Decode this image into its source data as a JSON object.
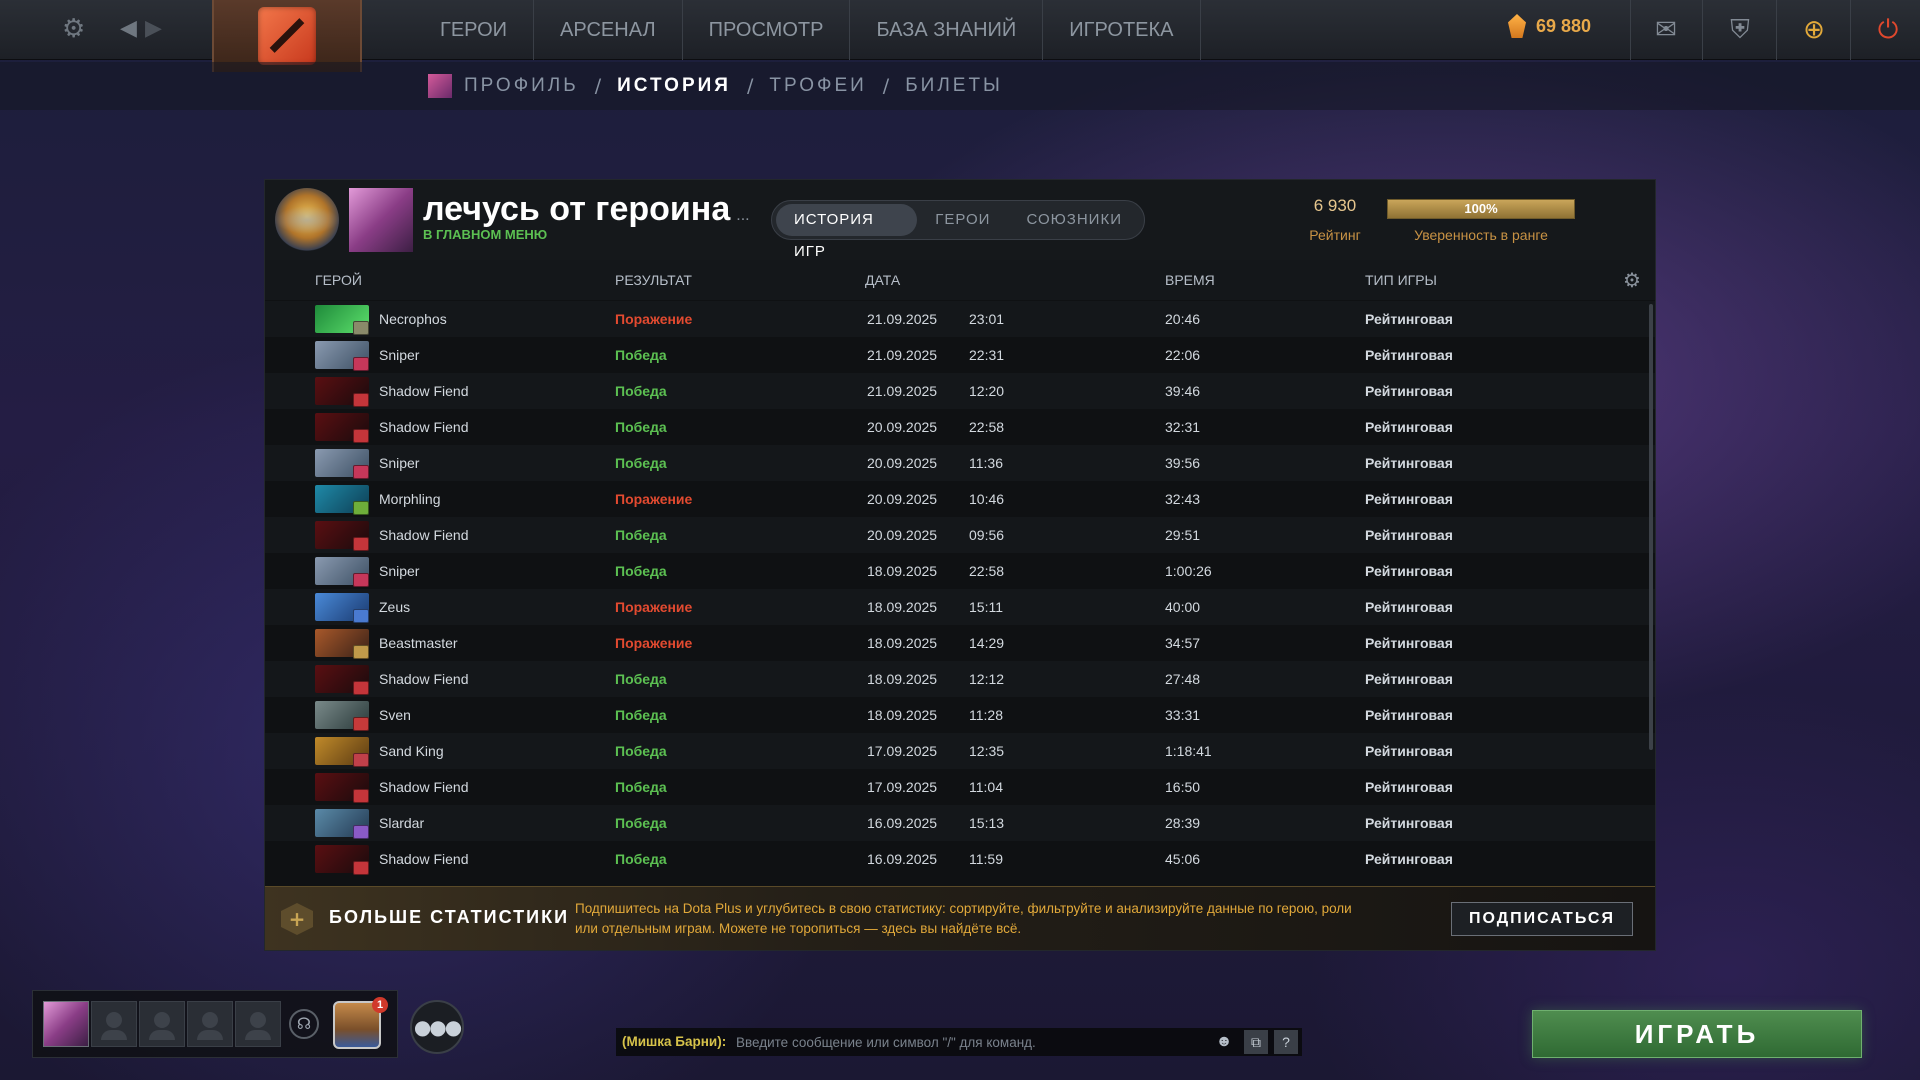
{
  "nav": [
    "ГЕРОИ",
    "АРСЕНАЛ",
    "ПРОСМОТР",
    "БАЗА ЗНАНИЙ",
    "ИГРОТЕКА"
  ],
  "currency": {
    "shards": "69 880"
  },
  "subnav": {
    "profile": "ПРОФИЛЬ",
    "history": "ИСТОРИЯ",
    "trophies": "ТРОФЕИ",
    "tickets": "БИЛЕТЫ",
    "sep": "/"
  },
  "profile": {
    "name": "лечусь от героина",
    "name_more": "...",
    "status": "В ГЛАВНОМ МЕНЮ",
    "rating_value": "6 930",
    "rating_label": "Рейтинг",
    "confidence_value": "100%",
    "confidence_fraction": 1.0,
    "confidence_label": "Уверенность в ранге"
  },
  "tabs": [
    "ИСТОРИЯ ИГР",
    "ГЕРОИ",
    "СОЮЗНИКИ"
  ],
  "columns": {
    "hero": "ГЕРОЙ",
    "result": "РЕЗУЛЬТАТ",
    "date": "ДАТА",
    "duration": "ВРЕМЯ",
    "type": "ТИП ИГРЫ"
  },
  "matches": [
    {
      "hero": "Necrophos",
      "result": "Поражение",
      "win": false,
      "date": "21.09.2025",
      "time": "23:01",
      "duration": "20:46",
      "type": "Рейтинговая",
      "color1": "#1e8a3a",
      "color2": "#5de06c",
      "badge": "#8a8a6a"
    },
    {
      "hero": "Sniper",
      "result": "Победа",
      "win": true,
      "date": "21.09.2025",
      "time": "22:31",
      "duration": "22:06",
      "type": "Рейтинговая",
      "color1": "#8a9ab0",
      "color2": "#3d5064",
      "badge": "#c6375a"
    },
    {
      "hero": "Shadow Fiend",
      "result": "Победа",
      "win": true,
      "date": "21.09.2025",
      "time": "12:20",
      "duration": "39:46",
      "type": "Рейтинговая",
      "color1": "#5a0f12",
      "color2": "#1a0a0c",
      "badge": "#c4353a"
    },
    {
      "hero": "Shadow Fiend",
      "result": "Победа",
      "win": true,
      "date": "20.09.2025",
      "time": "22:58",
      "duration": "32:31",
      "type": "Рейтинговая",
      "color1": "#5a0f12",
      "color2": "#1a0a0c",
      "badge": "#c4353a"
    },
    {
      "hero": "Sniper",
      "result": "Победа",
      "win": true,
      "date": "20.09.2025",
      "time": "11:36",
      "duration": "39:56",
      "type": "Рейтинговая",
      "color1": "#8a9ab0",
      "color2": "#3d5064",
      "badge": "#c6375a"
    },
    {
      "hero": "Morphling",
      "result": "Поражение",
      "win": false,
      "date": "20.09.2025",
      "time": "10:46",
      "duration": "32:43",
      "type": "Рейтинговая",
      "color1": "#1f8aa8",
      "color2": "#0d3e54",
      "badge": "#6eae3a"
    },
    {
      "hero": "Shadow Fiend",
      "result": "Победа",
      "win": true,
      "date": "20.09.2025",
      "time": "09:56",
      "duration": "29:51",
      "type": "Рейтинговая",
      "color1": "#5a0f12",
      "color2": "#1a0a0c",
      "badge": "#c4353a"
    },
    {
      "hero": "Sniper",
      "result": "Победа",
      "win": true,
      "date": "18.09.2025",
      "time": "22:58",
      "duration": "1:00:26",
      "type": "Рейтинговая",
      "color1": "#8a9ab0",
      "color2": "#3d5064",
      "badge": "#c6375a"
    },
    {
      "hero": "Zeus",
      "result": "Поражение",
      "win": false,
      "date": "18.09.2025",
      "time": "15:11",
      "duration": "40:00",
      "type": "Рейтинговая",
      "color1": "#4a8ad8",
      "color2": "#1a3a70",
      "badge": "#4a7ad0"
    },
    {
      "hero": "Beastmaster",
      "result": "Поражение",
      "win": false,
      "date": "18.09.2025",
      "time": "14:29",
      "duration": "34:57",
      "type": "Рейтинговая",
      "color1": "#a8582a",
      "color2": "#3a2218",
      "badge": "#c09a4a"
    },
    {
      "hero": "Shadow Fiend",
      "result": "Победа",
      "win": true,
      "date": "18.09.2025",
      "time": "12:12",
      "duration": "27:48",
      "type": "Рейтинговая",
      "color1": "#5a0f12",
      "color2": "#1a0a0c",
      "badge": "#c4353a"
    },
    {
      "hero": "Sven",
      "result": "Победа",
      "win": true,
      "date": "18.09.2025",
      "time": "11:28",
      "duration": "33:31",
      "type": "Рейтинговая",
      "color1": "#7a8a8a",
      "color2": "#2a3a3a",
      "badge": "#c63a3a"
    },
    {
      "hero": "Sand King",
      "result": "Победа",
      "win": true,
      "date": "17.09.2025",
      "time": "12:35",
      "duration": "1:18:41",
      "type": "Рейтинговая",
      "color1": "#c08a2a",
      "color2": "#5a3a12",
      "badge": "#c0404a"
    },
    {
      "hero": "Shadow Fiend",
      "result": "Победа",
      "win": true,
      "date": "17.09.2025",
      "time": "11:04",
      "duration": "16:50",
      "type": "Рейтинговая",
      "color1": "#5a0f12",
      "color2": "#1a0a0c",
      "badge": "#c4353a"
    },
    {
      "hero": "Slardar",
      "result": "Победа",
      "win": true,
      "date": "16.09.2025",
      "time": "15:13",
      "duration": "28:39",
      "type": "Рейтинговая",
      "color1": "#5a8aa8",
      "color2": "#243a52",
      "badge": "#8a5ac6"
    },
    {
      "hero": "Shadow Fiend",
      "result": "Победа",
      "win": true,
      "date": "16.09.2025",
      "time": "11:59",
      "duration": "45:06",
      "type": "Рейтинговая",
      "color1": "#5a0f12",
      "color2": "#1a0a0c",
      "badge": "#c4353a"
    }
  ],
  "banner": {
    "title": "БОЛЬШЕ СТАТИСТИКИ",
    "text": "Подпишитесь на Dota Plus и углубитесь в свою статистику: сортируйте, фильтруйте и анализируйте данные по герою, роли или отдельным играм. Можете не торопиться — здесь вы найдёте всё.",
    "button": "ПОДПИСАТЬСЯ"
  },
  "party": {
    "notification_count": "1"
  },
  "chat": {
    "channel": "(Мишка Барни):",
    "placeholder": "Введите сообщение или символ \"/\" для команд.",
    "help": "?"
  },
  "play_button": "ИГРАТЬ",
  "colors": {
    "win": "#5cc052",
    "loss": "#e24a30",
    "accent_gold": "#e2a93a",
    "play_green": "#3f7a40"
  },
  "icons": {
    "settings": "gear-icon",
    "back": "arrow-left-icon",
    "forward": "arrow-right-icon",
    "logo": "dota-logo-icon",
    "shards": "shard-icon",
    "mail": "mail-icon",
    "armory": "shield-sword-icon",
    "dota_plus": "plus-icon",
    "exit": "power-icon",
    "headset": "headset-icon",
    "group": "group-icon",
    "emoji": "emoji-icon",
    "screenshot": "screenshot-icon"
  }
}
